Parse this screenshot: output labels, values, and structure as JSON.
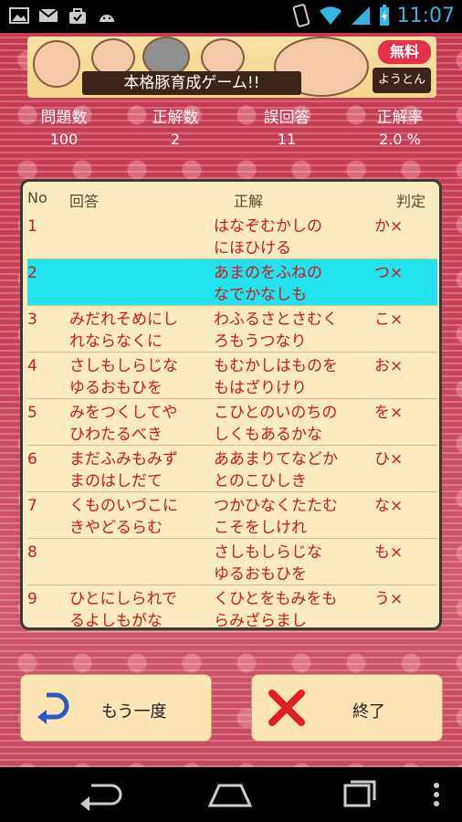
{
  "status_bar": {
    "time": "11:07"
  },
  "banner": {
    "title": "本格豚育成ゲーム!!",
    "free_badge": "無料",
    "logo": "ようとん場"
  },
  "stats": {
    "labels": [
      "問題数",
      "正解数",
      "誤回答",
      "正解率"
    ],
    "values": [
      "100",
      "2",
      "11",
      "2.0 %"
    ]
  },
  "table": {
    "headers": {
      "no": "No",
      "answer": "回答",
      "correct": "正解",
      "judge": "判定"
    },
    "rows": [
      {
        "no": "1",
        "answer": "",
        "correct": "はなぞむかしの\nにほひける",
        "judge": "か×"
      },
      {
        "no": "2",
        "answer": "",
        "correct": "あまのをふねの\nなでかなしも",
        "judge": "つ×"
      },
      {
        "no": "3",
        "answer": "みだれそめにし\nれならなくに",
        "correct": "わふるさとさむく\nろもうつなり",
        "judge": "こ×"
      },
      {
        "no": "4",
        "answer": "さしもしらじな\nゆるおもひを",
        "correct": "もむかしはものを\nもはざりけり",
        "judge": "お×"
      },
      {
        "no": "5",
        "answer": "みをつくしてや\nひわたるべき",
        "correct": "こひとのいのちの\nしくもあるかな",
        "judge": "を×"
      },
      {
        "no": "6",
        "answer": "まだふみもみず\nまのはしだて",
        "correct": "ああまりてなどか\nとのこひしき",
        "judge": "ひ×"
      },
      {
        "no": "7",
        "answer": "くものいづこに\nきやどるらむ",
        "correct": "つかひなくたたむ\nこそをしけれ",
        "judge": "な×"
      },
      {
        "no": "8",
        "answer": "",
        "correct": "さしもしらじな\nゆるおもひを",
        "judge": "も×"
      },
      {
        "no": "9",
        "answer": "ひとにしられで\nるよしもがな",
        "correct": "くひとをもみをも\nらみざらまし",
        "judge": "う×"
      }
    ]
  },
  "buttons": {
    "retry": "もう一度",
    "end": "終了"
  }
}
